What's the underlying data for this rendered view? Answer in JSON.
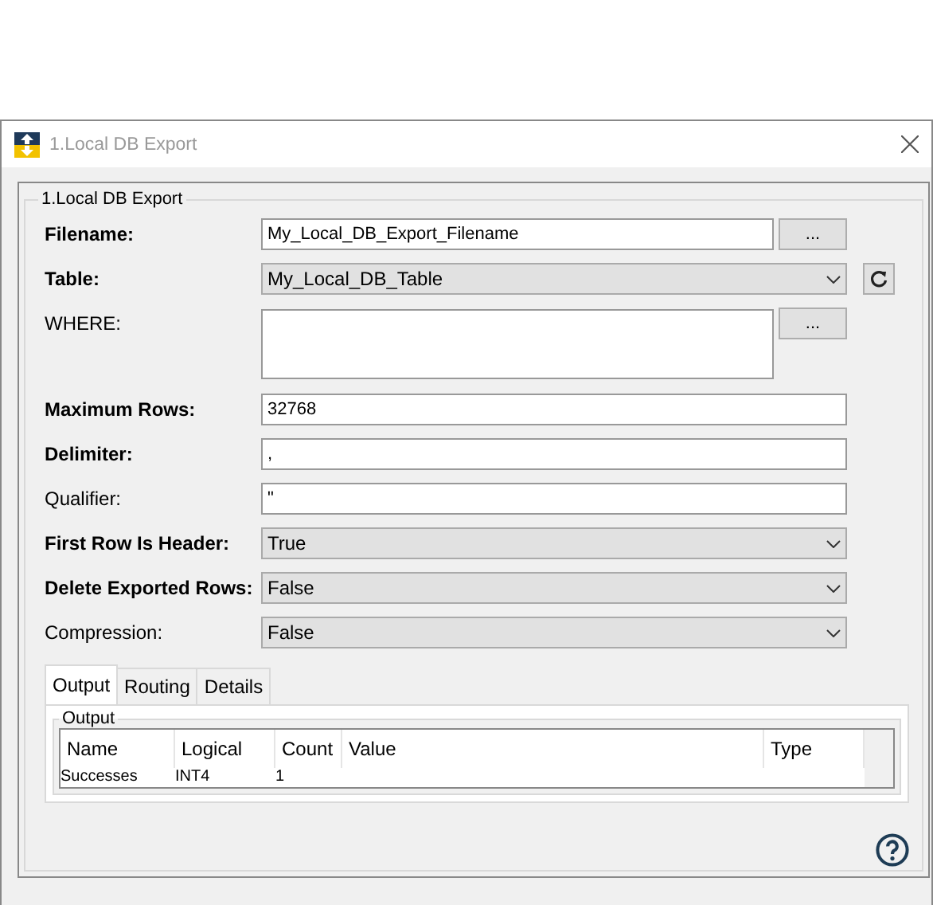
{
  "window": {
    "title": "1.Local DB Export"
  },
  "group": {
    "title": "1.Local DB Export"
  },
  "fields": [
    {
      "kind": "text",
      "label": "Filename:",
      "bold": true,
      "value": "My_Local_DB_Export_Filename",
      "browse": "..."
    },
    {
      "kind": "dropdown",
      "label": "Table:",
      "bold": true,
      "value": "My_Local_DB_Table",
      "refresh": true
    },
    {
      "kind": "multiline",
      "label": "WHERE:",
      "bold": false,
      "browse": "..."
    },
    {
      "kind": "text",
      "label": "Maximum Rows:",
      "bold": true,
      "value": "32768"
    },
    {
      "kind": "text",
      "label": "Delimiter:",
      "bold": true,
      "value": ","
    },
    {
      "kind": "text",
      "label": "Qualifier:",
      "bold": false,
      "value": "\""
    },
    {
      "kind": "dropdown",
      "label": "First Row Is Header:",
      "bold": true,
      "value": "True"
    },
    {
      "kind": "dropdown",
      "label": "Delete Exported Rows:",
      "bold": true,
      "value": "False"
    },
    {
      "kind": "dropdown",
      "label": "Compression:",
      "bold": false,
      "value": "False"
    }
  ],
  "tabs": [
    {
      "label": "Output",
      "selected": true
    },
    {
      "label": "Routing",
      "selected": false
    },
    {
      "label": "Details",
      "selected": false
    }
  ],
  "output": {
    "title": "Output",
    "columns": [
      "Name",
      "Logical",
      "Count",
      "Value",
      "Type"
    ],
    "rows": [
      [
        "Successes",
        "INT4",
        "1",
        "",
        ""
      ]
    ]
  }
}
